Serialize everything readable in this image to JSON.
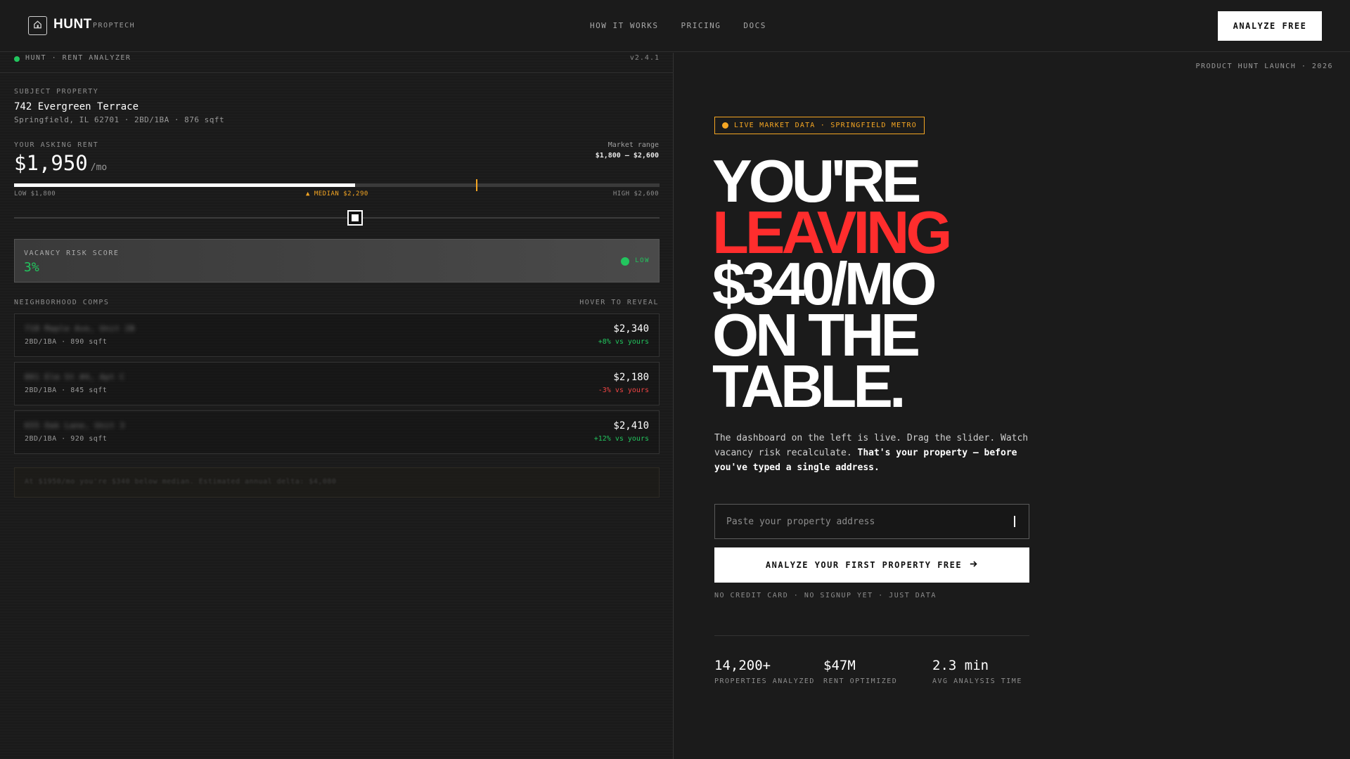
{
  "nav": {
    "brand": "HUNT",
    "tagline": "PROPTECH",
    "links": [
      "HOW IT WORKS",
      "PRICING",
      "DOCS"
    ],
    "cta_label": "ANALYZE FREE",
    "logo_icon": "house-icon"
  },
  "dashboard": {
    "title": "HUNT · RENT ANALYZER",
    "version": "v2.4.1",
    "subject": {
      "label": "SUBJECT PROPERTY",
      "address": "742 Evergreen Terrace",
      "meta": "Springfield, IL 62701 · 2BD/1BA · 876 sqft"
    },
    "rent": {
      "label": "YOUR ASKING RENT",
      "value": "$1,950",
      "unit": "/mo",
      "market_range_label": "Market range",
      "market_range_value": "$1,800 – $2,600",
      "low_label": "LOW $1,800",
      "median_label": "▲ MEDIAN $2,290",
      "high_label": "HIGH $2,600",
      "low": 1800,
      "median": 2290,
      "high": 2600,
      "current": 1950
    },
    "vacancy": {
      "label": "VACANCY RISK SCORE",
      "value": "3%",
      "level": "LOW",
      "color": "#22c55e"
    },
    "comps": {
      "label": "NEIGHBORHOOD COMPS",
      "hint": "HOVER TO REVEAL",
      "items": [
        {
          "address": "718 Maple Ave, Unit 2B",
          "meta": "2BD/1BA · 890 sqft",
          "price": "$2,340",
          "delta": "+8% vs yours",
          "trend": "up"
        },
        {
          "address": "801 Elm St #4, Apt C",
          "meta": "2BD/1BA · 845 sqft",
          "price": "$2,180",
          "delta": "-3% vs yours",
          "trend": "down"
        },
        {
          "address": "655 Oak Lane, Unit 3",
          "meta": "2BD/1BA · 920 sqft",
          "price": "$2,410",
          "delta": "+12% vs yours",
          "trend": "up"
        }
      ]
    },
    "summary": "At $1950/mo you're $340 below median. Estimated annual delta: $4,080"
  },
  "hero": {
    "launch_tag": "PRODUCT HUNT LAUNCH · 2026",
    "badge": "LIVE MARKET DATA · SPRINGFIELD METRO",
    "headline": [
      "YOU'RE",
      "LEAVING",
      "$340/MO",
      "ON THE",
      "TABLE."
    ],
    "description_plain": "The dashboard on the left is live. Drag the slider. Watch vacancy risk recalculate. ",
    "description_bold": "That's your property — before you've typed a single address.",
    "input_placeholder": "Paste your property address",
    "cta_label": "ANALYZE YOUR FIRST PROPERTY FREE",
    "cta_icon": "arrow-right-icon",
    "note": "NO CREDIT CARD · NO SIGNUP YET · JUST DATA",
    "stats": [
      {
        "value": "14,200+",
        "label": "PROPERTIES ANALYZED"
      },
      {
        "value": "$47M",
        "label": "RENT OPTIMIZED"
      },
      {
        "value": "2.3 min",
        "label": "AVG ANALYSIS TIME"
      }
    ]
  },
  "colors": {
    "accent_red": "#ff2d2d",
    "accent_amber": "#f5a623",
    "positive_green": "#22c55e",
    "negative_red": "#ef4444"
  }
}
